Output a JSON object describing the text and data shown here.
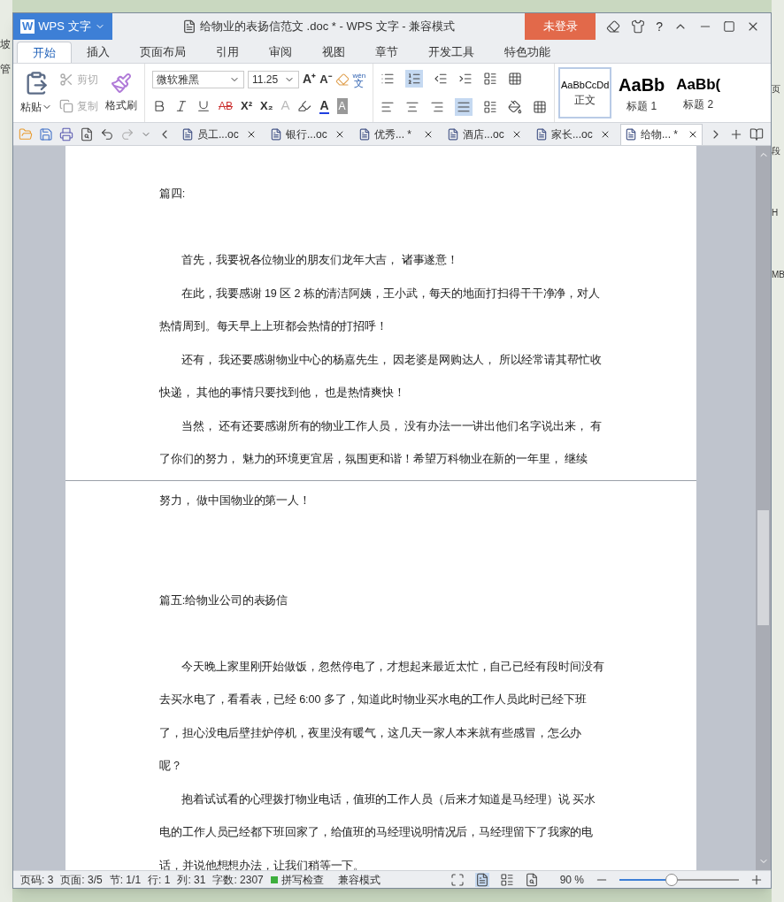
{
  "desktop": {
    "left_fragments": [
      "坡",
      "管"
    ],
    "right_fragments": [
      "页",
      "段",
      "H",
      "MB"
    ]
  },
  "window": {
    "app_logo": "W",
    "app_button": "WPS 文字",
    "title": "给物业的表扬信范文 .doc * - WPS 文字 - 兼容模式",
    "login_button": "未登录",
    "help": "?"
  },
  "ribbon_tabs": [
    {
      "label": "开始",
      "selected": true
    },
    {
      "label": "插入",
      "selected": false
    },
    {
      "label": "页面布局",
      "selected": false
    },
    {
      "label": "引用",
      "selected": false
    },
    {
      "label": "审阅",
      "selected": false
    },
    {
      "label": "视图",
      "selected": false
    },
    {
      "label": "章节",
      "selected": false
    },
    {
      "label": "开发工具",
      "selected": false
    },
    {
      "label": "特色功能",
      "selected": false
    }
  ],
  "clipboard": {
    "paste": "粘贴",
    "cut": {
      "label": "剪切",
      "disabled": true
    },
    "copy": {
      "label": "复制",
      "disabled": true
    },
    "format_painter": "格式刷"
  },
  "font": {
    "name": "微软雅黑",
    "size": "11.25",
    "phonetic_top": "wén",
    "phonetic_bottom": "文",
    "size_buttons": [
      {
        "kind": "grow",
        "label": "A⁺"
      },
      {
        "kind": "shrink",
        "label": "A⁻"
      }
    ],
    "format_buttons": [
      {
        "kind": "strike",
        "label": "AB"
      },
      {
        "kind": "sup",
        "label": "X²"
      },
      {
        "kind": "sub",
        "label": "X₂"
      },
      {
        "kind": "effect",
        "label": "A"
      },
      {
        "kind": "color",
        "label": "A"
      },
      {
        "kind": "shade",
        "label": "A"
      }
    ]
  },
  "styles": [
    {
      "preview": "AaBbCcDd",
      "name": "正文",
      "selected": true
    },
    {
      "preview": "AaBb",
      "name": "标题 1",
      "selected": false
    },
    {
      "preview": "AaBb(",
      "name": "标题 2",
      "selected": false
    }
  ],
  "doc_tabs": [
    {
      "label": "员工...oc",
      "selected": false
    },
    {
      "label": "银行...oc",
      "selected": false
    },
    {
      "label": "优秀... *",
      "selected": false
    },
    {
      "label": "酒店...oc",
      "selected": false
    },
    {
      "label": "家长...oc",
      "selected": false
    },
    {
      "label": "给物... *",
      "selected": true
    }
  ],
  "pages": [
    {
      "paragraphs": [
        {
          "kind": "heading",
          "text": "篇四:"
        },
        {
          "kind": "body",
          "text": "首先，我要祝各位物业的朋友们龙年大吉， 诸事遂意！"
        },
        {
          "kind": "body",
          "text": "在此，我要感谢 19 区 2 栋的清洁阿姨，王小武，每天的地面打扫得干干净净，对人热情周到。每天早上上班都会热情的打招呼！"
        },
        {
          "kind": "body",
          "text": "还有， 我还要感谢物业中心的杨嘉先生， 因老婆是网购达人， 所以经常请其帮忙收快递， 其他的事情只要找到他， 也是热情爽快！"
        },
        {
          "kind": "body",
          "text": "当然， 还有还要感谢所有的物业工作人员， 没有办法一一讲出他们名字说出来， 有了你们的努力， 魅力的环境更宜居，氛围更和谐！希望万科物业在新的一年里， 继续"
        }
      ]
    },
    {
      "paragraphs": [
        {
          "kind": "continuation",
          "text": "努力， 做中国物业的第一人！"
        },
        {
          "kind": "heading",
          "text": "篇五:给物业公司的表扬信"
        },
        {
          "kind": "body",
          "text": "今天晚上家里刚开始做饭，忽然停电了，才想起来最近太忙，自己已经有段时间没有去买水电了，看看表，已经 6:00 多了，知道此时物业买水电的工作人员此时已经下班了，担心没电后壁挂炉停机，夜里没有暖气，这几天一家人本来就有些感冒，怎么办呢？"
        },
        {
          "kind": "body",
          "text": "抱着试试看的心理拨打物业电话，值班的工作人员（后来才知道是马经理）说 买水电的工作人员已经都下班回家了，给值班的马经理说明情况后，马经理留下了我家的电话，并说他想想办法，让我们稍等一下。"
        }
      ]
    }
  ],
  "status_bar": {
    "fields": [
      "页码: 3",
      "页面: 3/5",
      "节: 1/1",
      "行: 1",
      "列: 31",
      "字数: 2307"
    ],
    "spell_check": {
      "label": "拼写检查",
      "on": true
    },
    "mode": "兼容模式",
    "zoom": "90 %",
    "zoom_slider": {
      "level": 0.44
    }
  }
}
